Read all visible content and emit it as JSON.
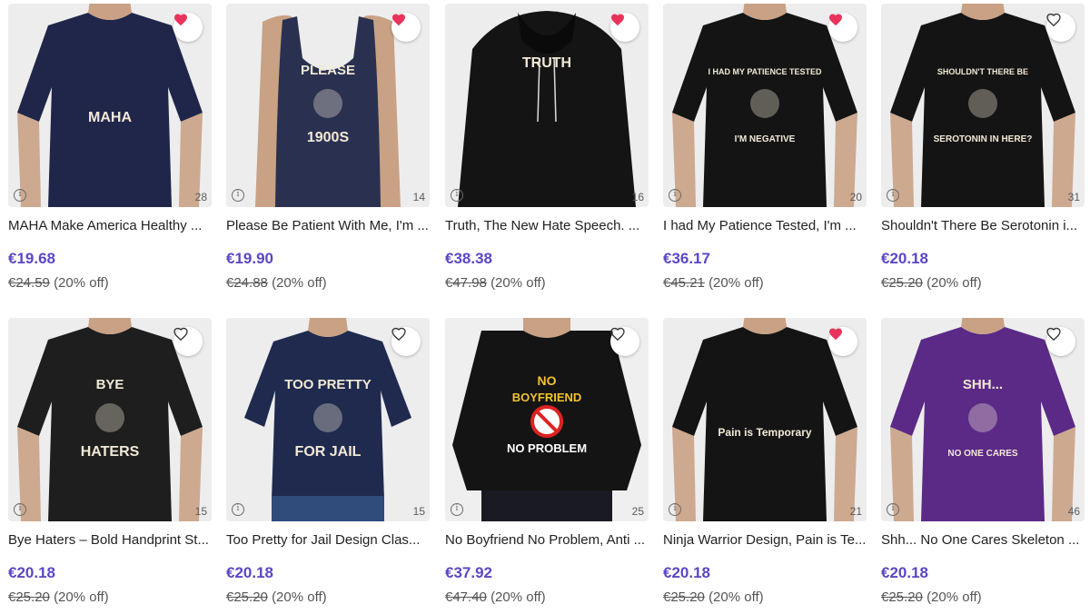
{
  "colors": {
    "accent": "#5a47c5",
    "heart_fill": "#e8335a",
    "card_bg": "#ededee"
  },
  "products": [
    {
      "title": "MAHA Make America Healthy ...",
      "price": "€19.68",
      "old_price": "€24.59",
      "discount": "(20% off)",
      "count": "28",
      "favorited": true,
      "shirt_color": "#20264a",
      "type": "tee",
      "design": [
        "MAHA"
      ]
    },
    {
      "title": "Please Be Patient With Me, I'm ...",
      "price": "€19.90",
      "old_price": "€24.88",
      "discount": "(20% off)",
      "count": "14",
      "favorited": true,
      "shirt_color": "#2a3150",
      "type": "tank",
      "design": [
        "PLEASE",
        "1900S"
      ]
    },
    {
      "title": "Truth, The New Hate Speech. ...",
      "price": "€38.38",
      "old_price": "€47.98",
      "discount": "(20% off)",
      "count": "16",
      "favorited": true,
      "shirt_color": "#141414",
      "type": "hoodie",
      "design": [
        "TRUTH"
      ]
    },
    {
      "title": "I had My Patience Tested, I'm ...",
      "price": "€36.17",
      "old_price": "€45.21",
      "discount": "(20% off)",
      "count": "20",
      "favorited": true,
      "shirt_color": "#141414",
      "type": "tee",
      "design": [
        "I HAD MY PATIENCE TESTED",
        "I'M NEGATIVE"
      ]
    },
    {
      "title": "Shouldn't There Be Serotonin i...",
      "price": "€20.18",
      "old_price": "€25.20",
      "discount": "(20% off)",
      "count": "31",
      "favorited": false,
      "shirt_color": "#141414",
      "type": "tee",
      "design": [
        "SHOULDN'T THERE BE",
        "SEROTONIN IN HERE?"
      ]
    },
    {
      "title": "Bye Haters – Bold Handprint St...",
      "price": "€20.18",
      "old_price": "€25.20",
      "discount": "(20% off)",
      "count": "15",
      "favorited": false,
      "shirt_color": "#1e1e1e",
      "type": "tee",
      "design": [
        "BYE",
        "HATERS"
      ]
    },
    {
      "title": "Too Pretty for Jail Design Clas...",
      "price": "€20.18",
      "old_price": "€25.20",
      "discount": "(20% off)",
      "count": "15",
      "favorited": false,
      "shirt_color": "#1f2a4e",
      "type": "fitted",
      "design": [
        "TOO PRETTY",
        "FOR JAIL"
      ]
    },
    {
      "title": "No Boyfriend No Problem, Anti ...",
      "price": "€37.92",
      "old_price": "€47.40",
      "discount": "(20% off)",
      "count": "25",
      "favorited": false,
      "shirt_color": "#141414",
      "type": "chiffon",
      "design": [
        "NO",
        "BOYFRIEND",
        "NO PROBLEM"
      ]
    },
    {
      "title": "Ninja Warrior Design, Pain is Te...",
      "price": "€20.18",
      "old_price": "€25.20",
      "discount": "(20% off)",
      "count": "21",
      "favorited": true,
      "shirt_color": "#141414",
      "type": "tee",
      "design": [
        "Pain is Temporary"
      ]
    },
    {
      "title": "Shh... No One Cares Skeleton ...",
      "price": "€20.18",
      "old_price": "€25.20",
      "discount": "(20% off)",
      "count": "46",
      "favorited": false,
      "shirt_color": "#5b2a86",
      "type": "tee",
      "design": [
        "SHH...",
        "NO ONE CARES"
      ]
    }
  ]
}
